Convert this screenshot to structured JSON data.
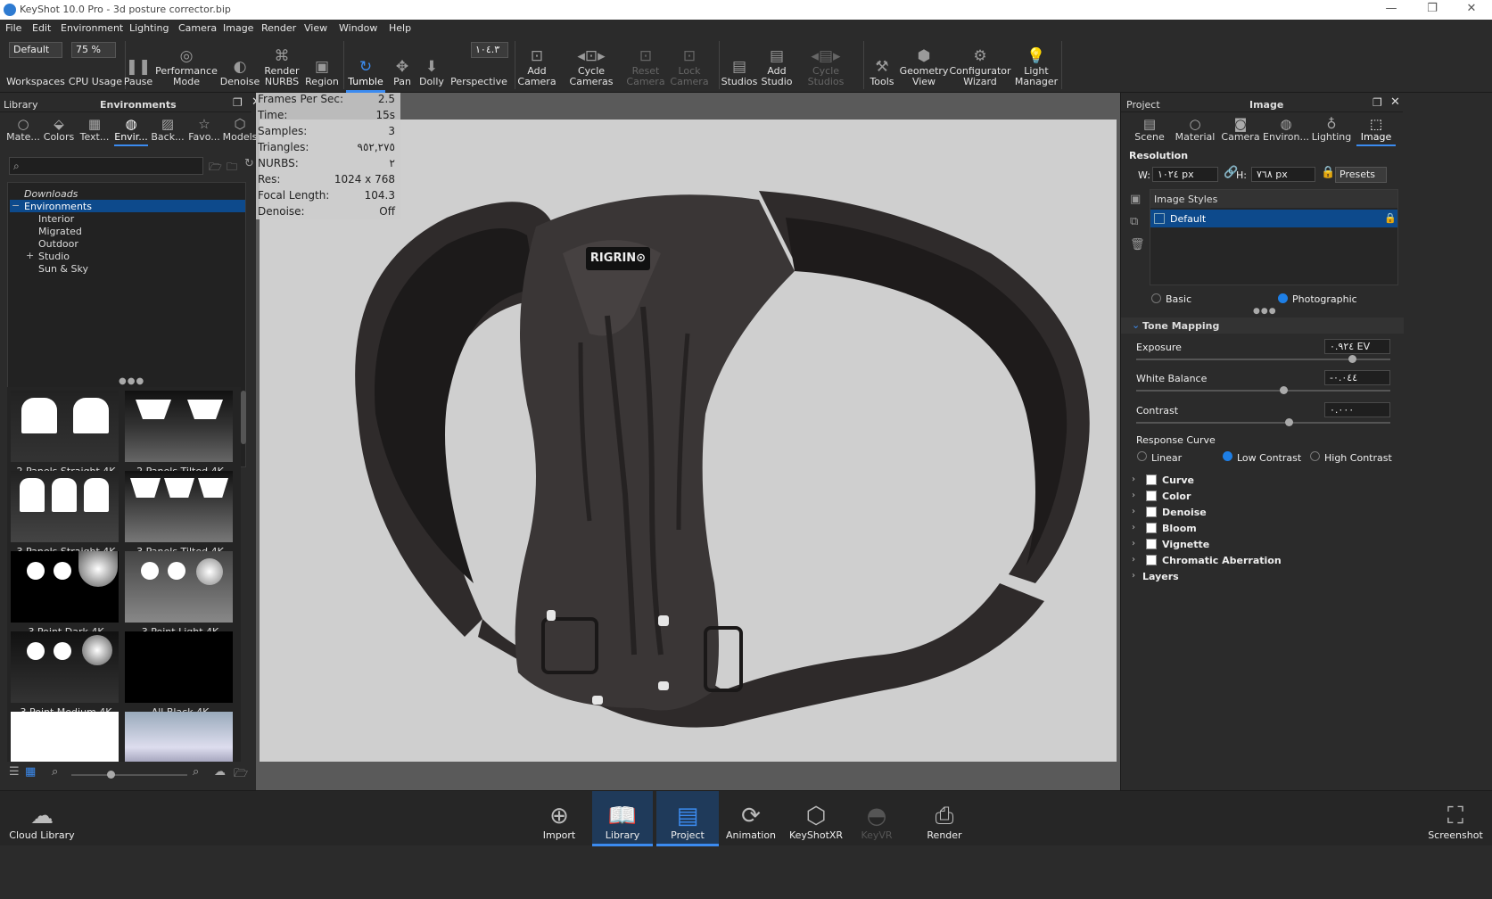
{
  "titlebar": {
    "title": "KeyShot 10.0 Pro  -  3d posture corrector.bip",
    "minimize": "—",
    "restore": "❐",
    "close": "✕"
  },
  "menu": [
    "File",
    "Edit",
    "Environment",
    "Lighting",
    "Camera",
    "Image",
    "Render",
    "View",
    "Window",
    "Help"
  ],
  "toolbar": {
    "workspace_value": "Default",
    "cpu_value": "75 %",
    "focal_value": "۱۰٤.۳",
    "workspaces": "Workspaces",
    "cpu": "CPU Usage",
    "pause": "Pause",
    "performance": "Performance\nMode",
    "denoise": "Denoise",
    "render_nurbs": "Render\nNURBS",
    "region": "Region",
    "tumble": "Tumble",
    "pan": "Pan",
    "dolly": "Dolly",
    "perspective": "Perspective",
    "add_camera": "Add\nCamera",
    "cycle_cameras": "Cycle\nCameras",
    "reset_camera": "Reset\nCamera",
    "lock_camera": "Lock\nCamera",
    "studios": "Studios",
    "add_studio": "Add\nStudio",
    "cycle_studios": "Cycle\nStudios",
    "tools": "Tools",
    "geometry_view": "Geometry\nView",
    "configurator_wizard": "Configurator\nWizard",
    "light_manager": "Light\nManager"
  },
  "library": {
    "header_left": "Library",
    "header_title": "Environments",
    "tabs": [
      "Mate...",
      "Colors",
      "Text...",
      "Envir...",
      "Back...",
      "Favo...",
      "Models"
    ],
    "tree": [
      "Downloads",
      "Environments",
      "Interior",
      "Migrated",
      "Outdoor",
      "Studio",
      "Sun & Sky"
    ],
    "thumbs": [
      "2 Panels Straight 4K",
      "2 Panels Tilted 4K",
      "3 Panels Straight 4K",
      "3 Panels Tilted 4K",
      "3 Point Dark 4K",
      "3 Point Light 4K",
      "3 Point Medium 4K",
      "All Black 4K"
    ]
  },
  "hud": {
    "rows": [
      {
        "k": "Frames Per Sec:",
        "v": "2.5"
      },
      {
        "k": "Time:",
        "v": "15s"
      },
      {
        "k": "Samples:",
        "v": "3"
      },
      {
        "k": "Triangles:",
        "v": "٩٥٢,٢٧٥"
      },
      {
        "k": "NURBS:",
        "v": "٢"
      },
      {
        "k": "Res:",
        "v": "1024 x 768"
      },
      {
        "k": "Focal Length:",
        "v": "104.3"
      },
      {
        "k": "Denoise:",
        "v": "Off"
      }
    ]
  },
  "product": {
    "brand": "RIGRIN⊙"
  },
  "project": {
    "header_left": "Project",
    "header_title": "Image",
    "tabs": [
      "Scene",
      "Material",
      "Camera",
      "Environ...",
      "Lighting",
      "Image"
    ],
    "resolution_label": "Resolution",
    "w_label": "W:",
    "w_value": "۱۰۲٤ px",
    "h_label": "H:",
    "h_value": "۷٦٨ px",
    "presets": "Presets",
    "styles_header": "Image Styles",
    "style_default": "Default",
    "mode_basic": "Basic",
    "mode_photographic": "Photographic",
    "tone_mapping": "Tone Mapping",
    "exposure_label": "Exposure",
    "exposure_value": "۰.۹۲٤ EV",
    "wb_label": "White Balance",
    "wb_value": "-۰.۰٤٤",
    "contrast_label": "Contrast",
    "contrast_value": "۰.۰۰۰",
    "response_label": "Response Curve",
    "rc_linear": "Linear",
    "rc_low": "Low Contrast",
    "rc_high": "High Contrast",
    "effects": [
      "Curve",
      "Color",
      "Denoise",
      "Bloom",
      "Vignette",
      "Chromatic Aberration"
    ],
    "layers": "Layers",
    "levels": {
      "exposure": 0.85,
      "white_balance": 0.58,
      "contrast": 0.6
    }
  },
  "bottombar": {
    "cloud": "Cloud Library",
    "import": "Import",
    "library": "Library",
    "project": "Project",
    "animation": "Animation",
    "keyshotxr": "KeyShotXR",
    "keyvr": "KeyVR",
    "render": "Render",
    "screenshot": "Screenshot"
  },
  "colors": {
    "accent": "#3b8bf0",
    "selected_row": "#0d4a8c"
  }
}
